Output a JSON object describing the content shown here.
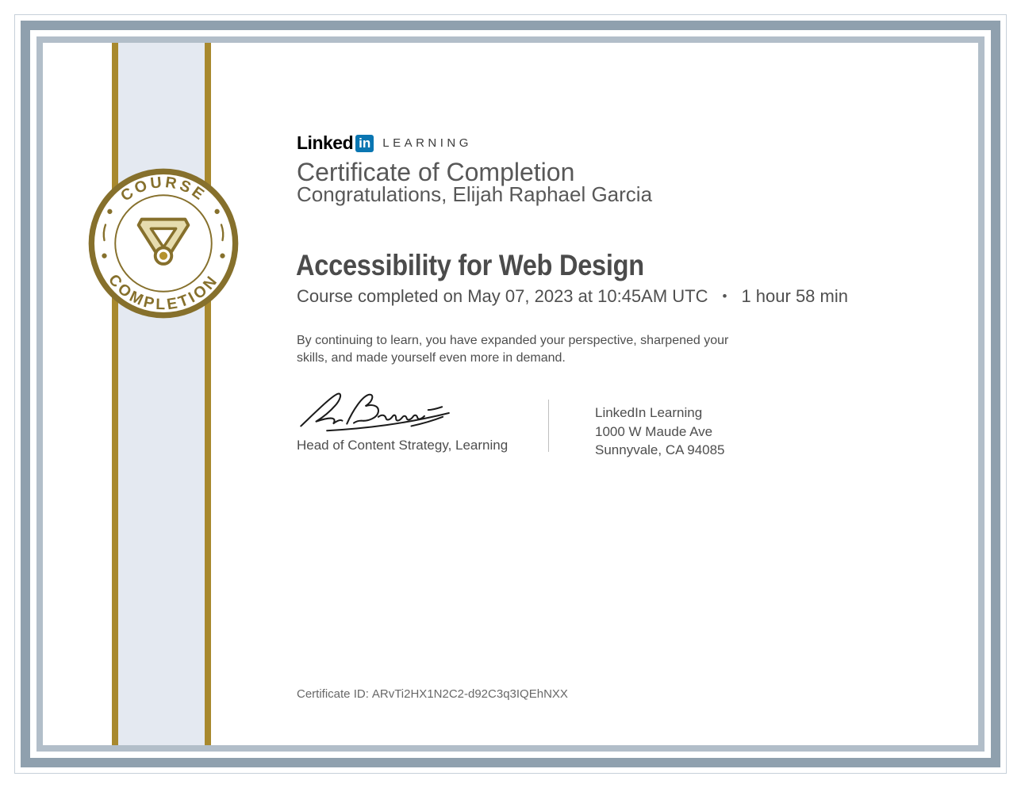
{
  "brand": {
    "logo_linked": "Linked",
    "logo_in": "in",
    "logo_learning": "LEARNING",
    "linkedin_blue": "#0a76b2"
  },
  "header": {
    "heading": "Certificate of Completion",
    "congratulations": "Congratulations, Elijah Raphael Garcia"
  },
  "course": {
    "title": "Accessibility for Web Design",
    "completed_text": "Course completed on May 07, 2023 at 10:45AM UTC",
    "separator": "•",
    "duration": "1 hour 58 min"
  },
  "body": {
    "line1": "By continuing to learn, you have expanded your perspective, sharpened your",
    "line2": "skills, and made yourself even more in demand."
  },
  "signature": {
    "signer_title": "Head of Content Strategy, Learning"
  },
  "issuer": {
    "name": "LinkedIn Learning",
    "address_line1": "1000 W Maude Ave",
    "address_line2": "Sunnyvale, CA 94085"
  },
  "footer": {
    "certificate_id_label": "Certificate ID:",
    "certificate_id": "ARvTi2HX1N2C2-d92C3q3IQEhNXX"
  },
  "badge": {
    "top_text": "COURSE",
    "bottom_text": "COMPLETION",
    "icon": "medal-icon",
    "gold": "#86702c"
  },
  "colors": {
    "frame_outer_band": "#8fa0ae",
    "frame_inner_band": "#b2bec9",
    "frame_thin_line": "#c7d0d9",
    "stripe_gold": "#a8892e",
    "band_fill": "#e4e9f1",
    "medal_fill": "#e6dcae",
    "medal_dot": "#b4922e",
    "text_gray": "#4e4e4e"
  }
}
